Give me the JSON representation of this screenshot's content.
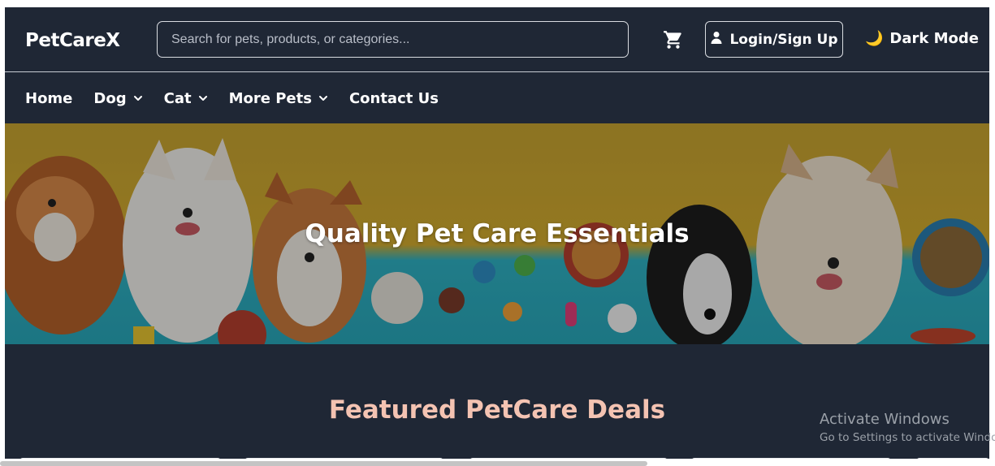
{
  "header": {
    "logo": "PetCareX",
    "search_placeholder": "Search for pets, products, or categories...",
    "cart_icon": "cart-icon",
    "login_label": "Login/Sign Up",
    "dark_mode_label": "Dark Mode"
  },
  "nav": {
    "items": [
      {
        "label": "Home",
        "has_dropdown": false
      },
      {
        "label": "Dog",
        "has_dropdown": true
      },
      {
        "label": "Cat",
        "has_dropdown": true
      },
      {
        "label": "More Pets",
        "has_dropdown": true
      },
      {
        "label": "Contact Us",
        "has_dropdown": false
      }
    ]
  },
  "hero": {
    "title": "Quality Pet Care Essentials"
  },
  "featured": {
    "title": "Featured PetCare Deals"
  },
  "watermark": {
    "title": "Activate Windows",
    "subtitle": "Go to Settings to activate Windo"
  },
  "colors": {
    "background": "#1f2735",
    "featured_title": "#f4c3b2",
    "hero_yellow": "#d4ad2f",
    "hero_teal": "#29a8bb"
  }
}
